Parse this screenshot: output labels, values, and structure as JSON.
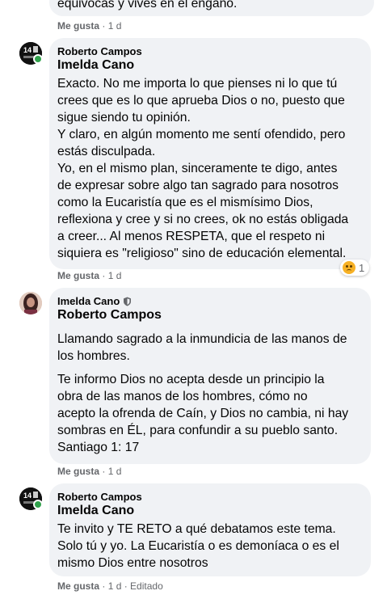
{
  "top_partial": {
    "text": "equivocas y vives en el engaño.",
    "like": "Me gusta",
    "time": "1 d"
  },
  "comments": [
    {
      "author": "Roberto Campos",
      "mention": "Imelda Cano",
      "body": "Exacto. No me importa lo que pienses ni lo que tú\ncrees que es lo que aprueba Dios o no, puesto que\nsigue siendo tu opinión.\nY claro, en algún momento me sentí ofendido, pero\nestás disculpada.\nYo, en el mismo plan, sinceramente te digo, antes\nde expresar sobre algo tan sagrado para nosotros\ncomo la Eucaristía que es el mismísimo Dios,\nreflexiona y cree y si no crees, ok no estás obligada\na creer... Al menos RESPETA, que el respeto ni\nsiquiera es \"religioso\" sino de educación elemental.",
      "like": "Me gusta",
      "time": "1 d",
      "reaction_count": "1"
    },
    {
      "author": "Imelda Cano",
      "mention": "Roberto Campos",
      "body1": "Llamando sagrado a la inmundicia de las manos de\nlos hombres.",
      "body2": "Te informo Dios no acepta desde un principio la\nobra de las manos de los hombres, cómo no\nacepto la ofrenda de Caín, y Dios no cambia, ni hay\nsombras en ÉL, para confundir a su pueblo santo.\nSantiago 1: 17",
      "like": "Me gusta",
      "time": "1 d"
    },
    {
      "author": "Roberto Campos",
      "mention": "Imelda Cano",
      "body": "Te invito y TE RETO a qué debatamos este tema.\nSolo tú y yo. La Eucaristía o es demoníaca o es el\nmismo Dios entre nosotros",
      "like": "Me gusta",
      "time": "1 d",
      "edited": "Editado"
    }
  ],
  "colors": {
    "bubble": "#f0f2f5",
    "meta": "#65676b",
    "online": "#31a24c"
  },
  "icons": [
    "verified-shield-icon",
    "sad-reaction-icon"
  ]
}
